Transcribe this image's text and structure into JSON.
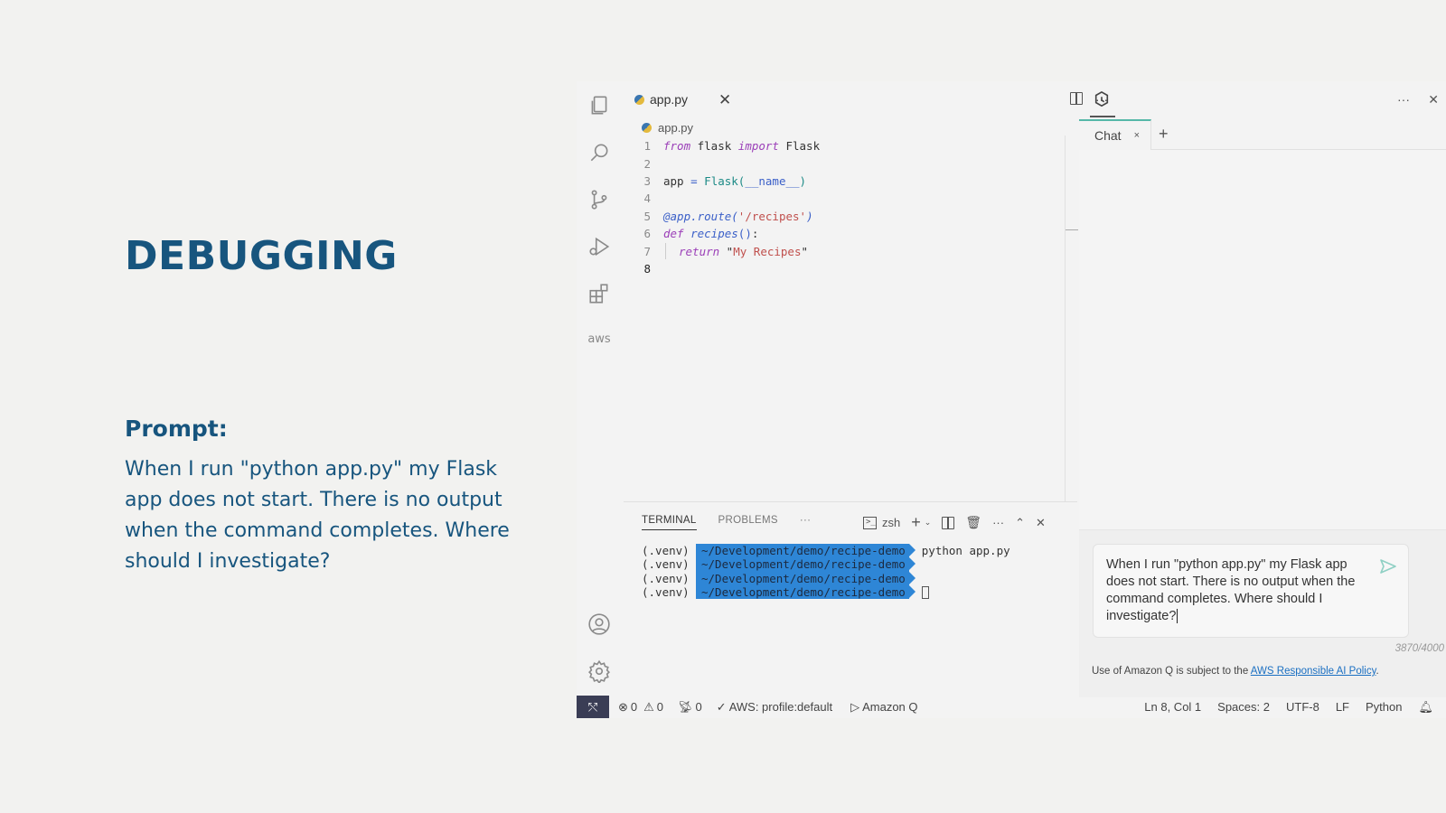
{
  "slide": {
    "title": "DEBUGGING",
    "prompt_label": "Prompt:",
    "prompt_text": "When I run \"python app.py\" my Flask app does not start. There is no output when the command completes. Where should I investigate?"
  },
  "activity_bar": {
    "items": [
      {
        "icon": "files-icon"
      },
      {
        "icon": "search-icon"
      },
      {
        "icon": "source-control-icon"
      },
      {
        "icon": "run-debug-icon"
      },
      {
        "icon": "extensions-icon"
      },
      {
        "icon": "aws-icon",
        "label": "aws"
      }
    ],
    "bottom_items": [
      {
        "icon": "account-icon"
      },
      {
        "icon": "settings-gear-icon"
      }
    ]
  },
  "editor": {
    "tab_label": "app.py",
    "tab_close": "✕",
    "more_actions": "···",
    "breadcrumb": "app.py",
    "lines": [
      {
        "n": "1",
        "tokens": [
          [
            "kw",
            "from"
          ],
          [
            "ct",
            " flask "
          ],
          [
            "kw",
            "import"
          ],
          [
            "ct",
            " Flask"
          ]
        ]
      },
      {
        "n": "2",
        "tokens": []
      },
      {
        "n": "3",
        "tokens": [
          [
            "ct",
            "app "
          ],
          [
            "var",
            "="
          ],
          [
            "ct",
            " "
          ],
          [
            "fn",
            "Flask("
          ],
          [
            "var",
            "__name__"
          ],
          [
            "fn",
            ")"
          ]
        ]
      },
      {
        "n": "4",
        "tokens": []
      },
      {
        "n": "5",
        "tokens": [
          [
            "deco",
            "@app.route("
          ],
          [
            "str",
            "'/recipes'"
          ],
          [
            "deco",
            ")"
          ]
        ]
      },
      {
        "n": "6",
        "tokens": [
          [
            "kw",
            "def"
          ],
          [
            "ct",
            " "
          ],
          [
            "deco",
            "recipes"
          ],
          [
            "var",
            "()"
          ],
          [
            "ct",
            ":"
          ]
        ]
      },
      {
        "n": "7",
        "indent": true,
        "tokens": [
          [
            "kw",
            "return"
          ],
          [
            "ct",
            " \""
          ],
          [
            "str",
            "My Recipes"
          ],
          [
            "ct",
            "\""
          ]
        ]
      },
      {
        "n": "8",
        "active": true,
        "tokens": []
      }
    ]
  },
  "terminal": {
    "tabs": [
      {
        "label": "TERMINAL",
        "active": true
      },
      {
        "label": "PROBLEMS",
        "active": false
      }
    ],
    "tabs_more": "···",
    "shell": "zsh",
    "lines": [
      {
        "venv": "(.venv)",
        "path": "~/Development/demo/recipe-demo",
        "cmd": "python app.py"
      },
      {
        "venv": "(.venv)",
        "path": "~/Development/demo/recipe-demo",
        "cmd": ""
      },
      {
        "venv": "(.venv)",
        "path": "~/Development/demo/recipe-demo",
        "cmd": ""
      },
      {
        "venv": "(.venv)",
        "path": "~/Development/demo/recipe-demo",
        "cmd": "",
        "cursor": true
      }
    ]
  },
  "chat": {
    "more_actions": "···",
    "close": "✕",
    "tab_label": "Chat",
    "tab_close": "×",
    "add_tab": "+",
    "input_value": "When I run \"python app.py\" my Flask app does not start. There is no output when the command completes. Where should I investigate?",
    "char_count": "3870/4000",
    "policy_text": "Use of Amazon Q is subject to the ",
    "policy_link": "AWS Responsible AI Policy",
    "policy_end": ".",
    "accent": "#56b8a8"
  },
  "status_bar": {
    "errors": "0",
    "warnings": "0",
    "ports": "0",
    "aws_profile": "AWS: profile:default",
    "amazon_q": "Amazon Q",
    "position": "Ln 8, Col 1",
    "spaces": "Spaces: 2",
    "encoding": "UTF-8",
    "eol": "LF",
    "language": "Python"
  }
}
